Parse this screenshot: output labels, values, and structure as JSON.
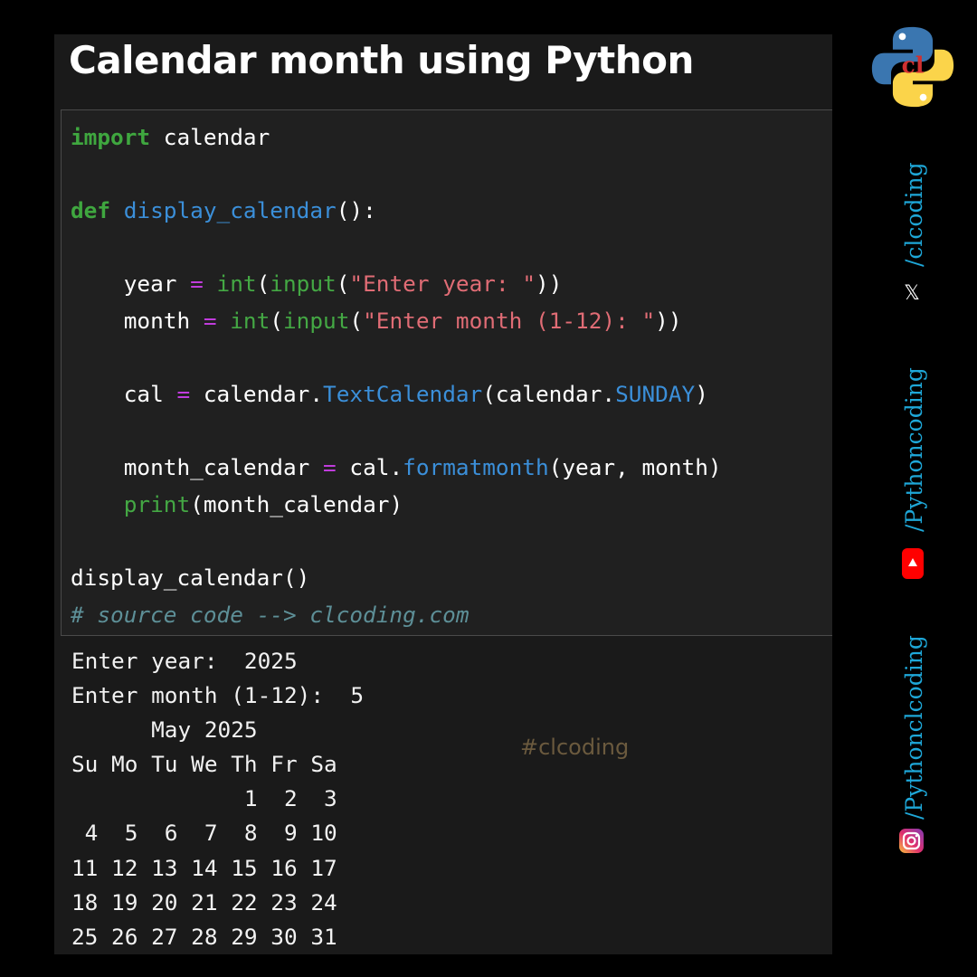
{
  "title": "Calendar month using Python",
  "code_lines": [
    [
      {
        "t": "import",
        "c": "kw"
      },
      {
        "t": " calendar"
      }
    ],
    [],
    [
      {
        "t": "def",
        "c": "kw"
      },
      {
        "t": " "
      },
      {
        "t": "display_calendar",
        "c": "fn"
      },
      {
        "t": "():"
      }
    ],
    [],
    [
      {
        "t": "    year "
      },
      {
        "t": "=",
        "c": "op"
      },
      {
        "t": " "
      },
      {
        "t": "int",
        "c": "bi"
      },
      {
        "t": "("
      },
      {
        "t": "input",
        "c": "bi"
      },
      {
        "t": "("
      },
      {
        "t": "\"Enter year: \"",
        "c": "st"
      },
      {
        "t": "))"
      }
    ],
    [
      {
        "t": "    month "
      },
      {
        "t": "=",
        "c": "op"
      },
      {
        "t": " "
      },
      {
        "t": "int",
        "c": "bi"
      },
      {
        "t": "("
      },
      {
        "t": "input",
        "c": "bi"
      },
      {
        "t": "("
      },
      {
        "t": "\"Enter month (1-12): \"",
        "c": "st"
      },
      {
        "t": "))"
      }
    ],
    [],
    [
      {
        "t": "    cal "
      },
      {
        "t": "=",
        "c": "op"
      },
      {
        "t": " calendar."
      },
      {
        "t": "TextCalendar",
        "c": "at"
      },
      {
        "t": "(calendar."
      },
      {
        "t": "SUNDAY",
        "c": "at"
      },
      {
        "t": ")"
      }
    ],
    [],
    [
      {
        "t": "    month_calendar "
      },
      {
        "t": "=",
        "c": "op"
      },
      {
        "t": " cal."
      },
      {
        "t": "formatmonth",
        "c": "at"
      },
      {
        "t": "(year, month)"
      }
    ],
    [
      {
        "t": "    "
      },
      {
        "t": "print",
        "c": "bi"
      },
      {
        "t": "(month_calendar)"
      }
    ],
    [],
    [
      {
        "t": "display_calendar()"
      }
    ],
    [
      {
        "t": "# source code --> clcoding.com",
        "c": "cm"
      }
    ]
  ],
  "output_lines": [
    "Enter year:  2025",
    "Enter month (1-12):  5",
    "      May 2025",
    "Su Mo Tu We Th Fr Sa",
    "             1  2  3",
    " 4  5  6  7  8  9 10",
    "11 12 13 14 15 16 17",
    "18 19 20 21 22 23 24",
    "25 26 27 28 29 30 31"
  ],
  "watermark": "#clcoding",
  "social": {
    "x_handle": "/clcoding",
    "x_icon": "𝕏",
    "youtube_handle": "/Pythoncoding",
    "instagram_handle": "/Pythonclcoding"
  },
  "colors": {
    "keyword": "#3fa73f",
    "function": "#3b8fd9",
    "operator": "#c03cdc",
    "string": "#e06c75",
    "comment": "#5d8f97",
    "handle": "#1ea7d8"
  },
  "icons": [
    "python-logo-icon",
    "x-icon",
    "youtube-icon",
    "instagram-icon"
  ]
}
